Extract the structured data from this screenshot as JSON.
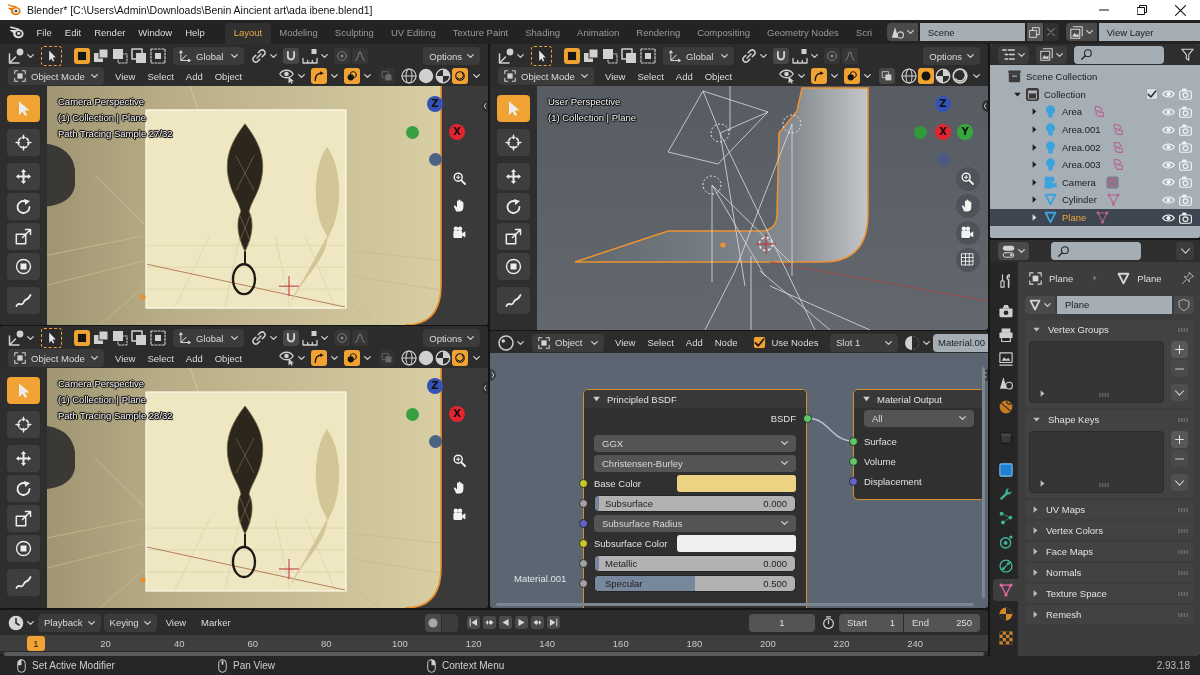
{
  "title_bar": {
    "title": "Blender* [C:\\Users\\Admin\\Downloads\\Benin Aincient art\\ada ibene.blend1]"
  },
  "top_bar": {
    "menus": [
      "File",
      "Edit",
      "Render",
      "Window",
      "Help"
    ],
    "workspaces": [
      {
        "label": "Layout",
        "selected": true
      },
      {
        "label": "Modeling",
        "selected": false
      },
      {
        "label": "Sculpting",
        "selected": false
      },
      {
        "label": "UV Editing",
        "selected": false
      },
      {
        "label": "Texture Paint",
        "selected": false
      },
      {
        "label": "Shading",
        "selected": false
      },
      {
        "label": "Animation",
        "selected": false
      },
      {
        "label": "Rendering",
        "selected": false
      },
      {
        "label": "Compositing",
        "selected": false
      },
      {
        "label": "Geometry Nodes",
        "selected": false
      },
      {
        "label": "Scri",
        "selected": false
      }
    ],
    "scene": "Scene",
    "view_layer": "View Layer"
  },
  "viewports": [
    {
      "kind": "camera",
      "select_modes": [
        {
          "kind": "new",
          "selected": true
        },
        {
          "kind": "extend",
          "selected": false
        },
        {
          "kind": "subtract",
          "selected": false
        },
        {
          "kind": "invert",
          "selected": false
        },
        {
          "kind": "intersect",
          "selected": false
        }
      ],
      "orientation": "Global",
      "options": "Options",
      "mode": "Object Mode",
      "menus": [
        "View",
        "Select",
        "Add",
        "Object"
      ],
      "xray_disabled": true,
      "shading": [
        {
          "kind": "wireframe",
          "selected": false
        },
        {
          "kind": "solid",
          "selected": false
        },
        {
          "kind": "material",
          "selected": false
        },
        {
          "kind": "rendered",
          "selected": true
        }
      ],
      "overlay_lines": [
        "Camera Perspective",
        "(1) Collection | Plane",
        "Path Tracing Sample 27/32"
      ],
      "gizmo": [
        {
          "kind": "up",
          "label": "Z",
          "color": "#3552b5"
        },
        {
          "kind": "left",
          "color": "#37a040"
        },
        {
          "kind": "right",
          "label": "X",
          "color": "#e2252f"
        },
        {
          "kind": "down",
          "color": "#4a6284"
        }
      ],
      "tools": [
        {
          "kind": "select",
          "selected": true
        },
        {
          "kind": "cursor",
          "selected": false
        },
        {
          "kind": "move",
          "selected": false
        },
        {
          "kind": "rotate",
          "selected": false
        },
        {
          "kind": "scale",
          "selected": false
        },
        {
          "kind": "transform",
          "selected": false
        },
        {
          "kind": "annotate",
          "selected": false
        }
      ]
    },
    {
      "kind": "camera",
      "select_modes": [
        {
          "kind": "new",
          "selected": true
        },
        {
          "kind": "extend",
          "selected": false
        },
        {
          "kind": "subtract",
          "selected": false
        },
        {
          "kind": "invert",
          "selected": false
        },
        {
          "kind": "intersect",
          "selected": false
        }
      ],
      "orientation": "Global",
      "options": "Options",
      "mode": "Object Mode",
      "menus": [
        "View",
        "Select",
        "Add",
        "Object"
      ],
      "xray_disabled": true,
      "shading": [
        {
          "kind": "wireframe",
          "selected": false
        },
        {
          "kind": "solid",
          "selected": false
        },
        {
          "kind": "material",
          "selected": false
        },
        {
          "kind": "rendered",
          "selected": true
        }
      ],
      "overlay_lines": [
        "Camera Perspective",
        "(1) Collection | Plane",
        "Path Tracing Sample 28/32"
      ],
      "gizmo": [
        {
          "kind": "up",
          "label": "Z",
          "color": "#3552b5"
        },
        {
          "kind": "left",
          "color": "#37a040"
        },
        {
          "kind": "right",
          "label": "X",
          "color": "#e2252f"
        },
        {
          "kind": "down",
          "color": "#4a6284"
        }
      ],
      "tools": [
        {
          "kind": "select",
          "selected": true
        },
        {
          "kind": "cursor",
          "selected": false
        },
        {
          "kind": "move",
          "selected": false
        },
        {
          "kind": "rotate",
          "selected": false
        },
        {
          "kind": "scale",
          "selected": false
        },
        {
          "kind": "transform",
          "selected": false
        },
        {
          "kind": "annotate",
          "selected": false
        }
      ]
    },
    {
      "kind": "user",
      "select_modes": [
        {
          "kind": "new",
          "selected": true
        },
        {
          "kind": "extend",
          "selected": false
        },
        {
          "kind": "subtract",
          "selected": false
        },
        {
          "kind": "invert",
          "selected": false
        },
        {
          "kind": "intersect",
          "selected": false
        }
      ],
      "orientation": "Global",
      "options": "Options",
      "mode": "Object Mode",
      "menus": [
        "View",
        "Select",
        "Add",
        "Object"
      ],
      "xray_disabled": false,
      "shading": [
        {
          "kind": "wireframe",
          "selected": false
        },
        {
          "kind": "solid",
          "selected": true
        },
        {
          "kind": "material",
          "selected": false
        },
        {
          "kind": "rendered",
          "selected": false
        }
      ],
      "overlay_lines": [
        "User Perspective",
        "(1) Collection | Plane"
      ],
      "gizmo": [
        {
          "kind": "up",
          "label": "Z",
          "color": "#3552b5"
        },
        {
          "kind": "left",
          "color": "#2f9a3a"
        },
        {
          "kind": "center",
          "label": "X",
          "color": "#e2252f"
        },
        {
          "kind": "right",
          "label": "Y",
          "color": "#35a83c"
        },
        {
          "kind": "down",
          "color": "#4a5a84"
        }
      ],
      "tools": [
        {
          "kind": "select",
          "selected": true
        },
        {
          "kind": "cursor",
          "selected": false
        },
        {
          "kind": "move",
          "selected": false
        },
        {
          "kind": "rotate",
          "selected": false
        },
        {
          "kind": "scale",
          "selected": false
        },
        {
          "kind": "transform",
          "selected": false
        },
        {
          "kind": "annotate",
          "selected": false
        }
      ]
    }
  ],
  "node_editor": {
    "object_type": "Object",
    "menus": [
      "View",
      "Select",
      "Add",
      "Node"
    ],
    "use_nodes": {
      "label": "Use Nodes",
      "checked": true
    },
    "slot": "Slot 1",
    "material": "Material.00",
    "tree_label": "Material.001",
    "nodes": [
      {
        "kind": "principled",
        "title": "Principled BSDF",
        "selected": true,
        "rows": [
          {
            "kind": "output",
            "label": "BSDF"
          },
          {
            "kind": "dropdown",
            "value": "GGX"
          },
          {
            "kind": "dropdown",
            "value": "Christensen-Burley"
          },
          {
            "kind": "color",
            "label": "Base Color",
            "color": "#ecd283"
          },
          {
            "kind": "slider",
            "label": "Subsurface",
            "value": "0.000",
            "level": 0
          },
          {
            "kind": "vector_dropdown",
            "value": "Subsurface Radius"
          },
          {
            "kind": "color",
            "label": "Subsurface Color",
            "color": "#f0f0f0"
          },
          {
            "kind": "slider",
            "label": "Metallic",
            "value": "0.000",
            "level": 0
          },
          {
            "kind": "slider",
            "label": "Specular",
            "value": "0.500",
            "level": 0.5
          }
        ]
      },
      {
        "kind": "output",
        "title": "Material Output",
        "selected": true,
        "rows": [
          {
            "kind": "dropdown",
            "value": "All"
          },
          {
            "kind": "shader_input",
            "label": "Surface"
          },
          {
            "kind": "shader_input",
            "label": "Volume"
          },
          {
            "kind": "vector_input",
            "label": "Displacement"
          }
        ]
      }
    ]
  },
  "outliner": {
    "tree": [
      {
        "label": "Scene Collection",
        "kind": "scene_collection",
        "selected": false,
        "children": [
          {
            "label": "Collection",
            "kind": "collection",
            "selected": false,
            "expanded": true,
            "checked": true,
            "visible": true,
            "renderable": true,
            "children": [
              {
                "label": "Area",
                "kind": "light",
                "selected": false,
                "expanded": false,
                "visible": true,
                "renderable": true
              },
              {
                "label": "Area.001",
                "kind": "light",
                "selected": false,
                "expanded": false,
                "visible": true,
                "renderable": true
              },
              {
                "label": "Area.002",
                "kind": "light",
                "selected": false,
                "expanded": false,
                "visible": true,
                "renderable": true
              },
              {
                "label": "Area.003",
                "kind": "light",
                "selected": false,
                "expanded": false,
                "visible": true,
                "renderable": true
              },
              {
                "label": "Camera",
                "kind": "camera",
                "selected": false,
                "expanded": false,
                "visible": true,
                "renderable": true
              },
              {
                "label": "Cylinder",
                "kind": "mesh",
                "selected": false,
                "expanded": false,
                "visible": true,
                "renderable": true
              },
              {
                "label": "Plane",
                "kind": "mesh",
                "selected": true,
                "expanded": false,
                "visible": true,
                "renderable": true
              }
            ]
          }
        ]
      }
    ]
  },
  "properties": {
    "tabs": [
      {
        "kind": "tool",
        "selected": false
      },
      {
        "kind": "render",
        "selected": false
      },
      {
        "kind": "output",
        "selected": false
      },
      {
        "kind": "view_layer",
        "selected": false
      },
      {
        "kind": "scene",
        "selected": false
      },
      {
        "kind": "world",
        "selected": false
      },
      {
        "kind": "collection",
        "selected": false
      },
      {
        "kind": "object",
        "selected": false
      },
      {
        "kind": "modifiers",
        "selected": false
      },
      {
        "kind": "particles",
        "selected": false
      },
      {
        "kind": "physics",
        "selected": false
      },
      {
        "kind": "constraints",
        "selected": false
      },
      {
        "kind": "data",
        "selected": true
      },
      {
        "kind": "material",
        "selected": false
      },
      {
        "kind": "texture",
        "selected": false
      }
    ],
    "breadcrumb": [
      {
        "kind": "object",
        "label": "Plane"
      },
      {
        "kind": "mesh",
        "label": "Plane"
      }
    ],
    "data_name": "Plane",
    "panels": [
      {
        "title": "Vertex Groups",
        "expanded": true
      },
      {
        "title": "Shape Keys",
        "expanded": true
      },
      {
        "title": "UV Maps",
        "expanded": false
      },
      {
        "title": "Vertex Colors",
        "expanded": false
      },
      {
        "title": "Face Maps",
        "expanded": false
      },
      {
        "title": "Normals",
        "expanded": false
      },
      {
        "title": "Texture Space",
        "expanded": false
      },
      {
        "title": "Remesh",
        "expanded": false
      }
    ]
  },
  "timeline": {
    "menus": [
      {
        "kind": "dropdown",
        "label": "Playback"
      },
      {
        "kind": "dropdown",
        "label": "Keying"
      },
      {
        "kind": "menu",
        "label": "View"
      },
      {
        "kind": "menu",
        "label": "Marker"
      }
    ],
    "auto_keying": false,
    "current_frame": "1",
    "start_label": "Start",
    "start": "1",
    "end_label": "End",
    "end": "250",
    "frame_marker": "1",
    "ticks": [
      "20",
      "40",
      "60",
      "80",
      "100",
      "120",
      "140",
      "160",
      "180",
      "200",
      "220",
      "240"
    ]
  },
  "status_bar": {
    "hints": [
      {
        "kind": "left_click",
        "label": "Set Active Modifier"
      },
      {
        "kind": "middle_click",
        "label": "Pan View"
      },
      {
        "kind": "right_click",
        "label": "Context Menu"
      }
    ],
    "version": "2.93.18"
  }
}
